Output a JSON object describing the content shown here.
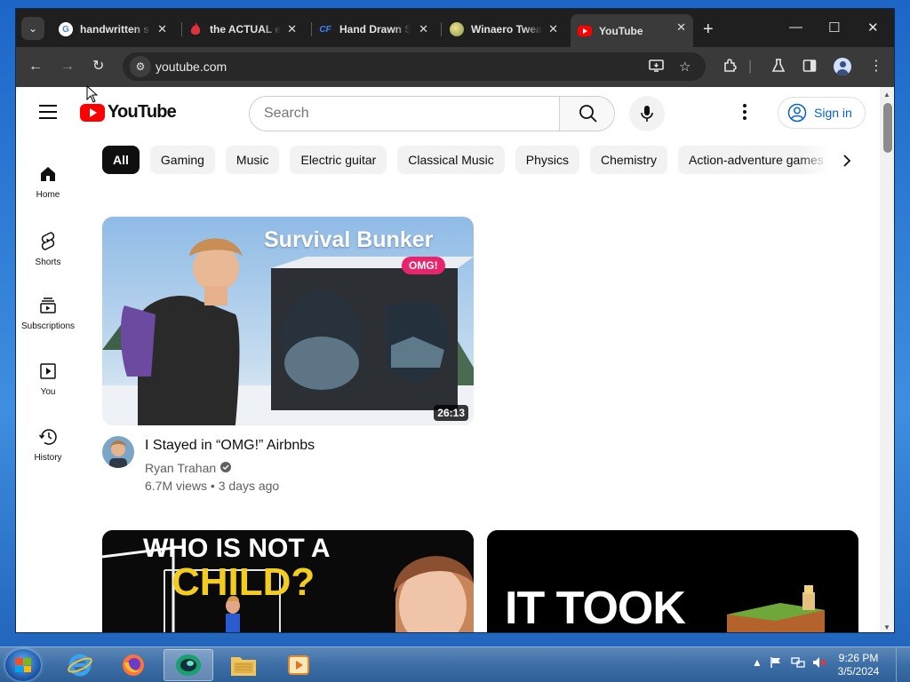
{
  "browser": {
    "tabs": [
      {
        "title": "handwritten s",
        "favicon": "google-icon",
        "active": false
      },
      {
        "title": "the ACTUAL e",
        "favicon": "flame-icon",
        "active": false
      },
      {
        "title": "Hand Drawn S",
        "favicon": "cf-icon",
        "active": false
      },
      {
        "title": "Winaero Twea",
        "favicon": "winaero-icon",
        "active": false
      },
      {
        "title": "YouTube",
        "favicon": "youtube-icon",
        "active": true
      }
    ],
    "url": "youtube.com"
  },
  "youtube": {
    "logo_text": "YouTube",
    "search_placeholder": "Search",
    "sign_in": "Sign in",
    "guide": [
      {
        "label": "Home",
        "icon": "home-icon"
      },
      {
        "label": "Shorts",
        "icon": "shorts-icon"
      },
      {
        "label": "Subscriptions",
        "icon": "subscriptions-icon"
      },
      {
        "label": "You",
        "icon": "you-icon"
      },
      {
        "label": "History",
        "icon": "history-icon"
      }
    ],
    "chips": [
      "All",
      "Gaming",
      "Music",
      "Electric guitar",
      "Classical Music",
      "Physics",
      "Chemistry",
      "Action-adventure games"
    ],
    "videos": [
      {
        "title": "I Stayed in “OMG!” Airbnbs",
        "channel": "Ryan Trahan",
        "views": "6.7M views",
        "age": "3 days ago",
        "duration": "26:13",
        "thumb_text": "Survival Bunker",
        "thumb_badge": "OMG!"
      },
      {
        "thumb_text_line1": "WHO IS NOT A",
        "thumb_text_line2": "CHILD?"
      },
      {
        "thumb_text": "IT TOOK"
      }
    ]
  },
  "taskbar": {
    "time": "9:26 PM",
    "date": "3/5/2024"
  },
  "colors": {
    "youtube_red": "#ff0000",
    "link_blue": "#065fd4",
    "chrome_dark": "#1f1f1f"
  }
}
